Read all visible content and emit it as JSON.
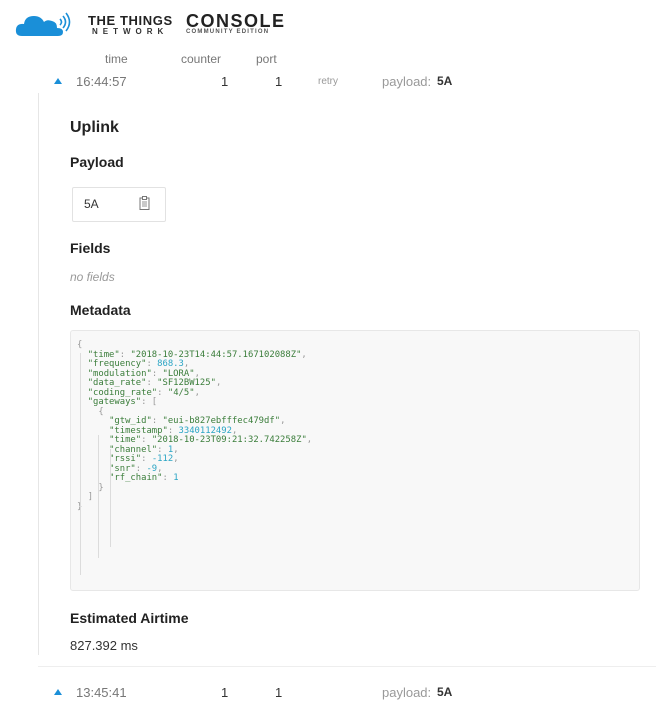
{
  "brand": {
    "line1": "THE THINGS",
    "line2": "NETWORK",
    "console": "CONSOLE",
    "edition": "COMMUNITY EDITION"
  },
  "columns": {
    "time": "time",
    "counter": "counter",
    "port": "port"
  },
  "rows": [
    {
      "time": "16:44:57",
      "counter": "1",
      "port": "1",
      "retry": "retry",
      "payload_label": "payload:",
      "payload": "5A"
    },
    {
      "time": "13:45:41",
      "counter": "1",
      "port": "1",
      "payload_label": "payload:",
      "payload": "5A"
    }
  ],
  "detail": {
    "title": "Uplink",
    "payload_heading": "Payload",
    "payload_hex": "5A",
    "fields_heading": "Fields",
    "fields_empty": "no fields",
    "metadata_heading": "Metadata",
    "metadata": {
      "time": "2018-10-23T14:44:57.167102088Z",
      "frequency": "868.3",
      "modulation": "LORA",
      "data_rate": "SF12BW125",
      "coding_rate": "4/5",
      "gateway": {
        "gtw_id": "eui-b827ebfffec479df",
        "timestamp": "3340112492",
        "time": "2018-10-23T09:21:32.742258Z",
        "channel": "1",
        "rssi": "-112",
        "snr": "-9",
        "rf_chain": "1"
      }
    },
    "airtime_heading": "Estimated Airtime",
    "airtime_value": "827.392 ms"
  },
  "colors": {
    "accent": "#1a8fd8",
    "cloud": "#1a8fd8"
  },
  "icons": {
    "expand": "triangle-up-icon",
    "copy": "clipboard-icon"
  }
}
